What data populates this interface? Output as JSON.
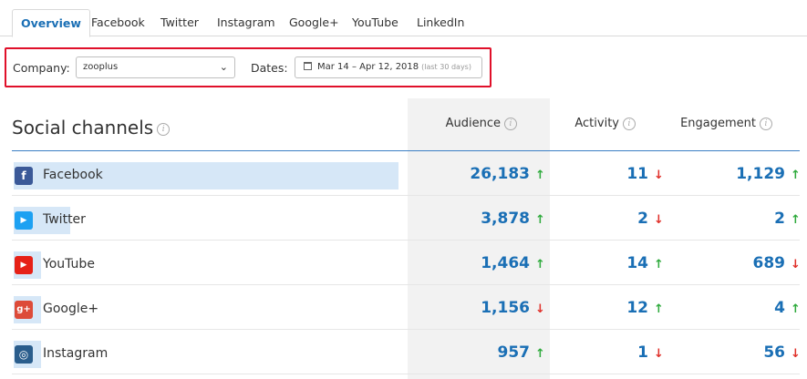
{
  "tabs": [
    {
      "label": "Overview",
      "active": true
    },
    {
      "label": "Facebook",
      "active": false
    },
    {
      "label": "Twitter",
      "active": false
    },
    {
      "label": "Instagram",
      "active": false
    },
    {
      "label": "Google+",
      "active": false
    },
    {
      "label": "YouTube",
      "active": false
    },
    {
      "label": "LinkedIn",
      "active": false
    }
  ],
  "filters": {
    "company_label": "Company:",
    "company_value": "zooplus",
    "dates_label": "Dates:",
    "dates_value": "Mar 14 – Apr 12, 2018",
    "dates_sub": "(last 30 days)"
  },
  "table": {
    "title": "Social channels",
    "columns": [
      "Audience",
      "Activity",
      "Engagement"
    ],
    "rows": [
      {
        "channel": "Facebook",
        "icon": "facebook-icon",
        "audience": "26,183",
        "audience_trend": "up",
        "activity": "11",
        "activity_trend": "down",
        "engagement": "1,129",
        "engagement_trend": "up",
        "share": 1.0
      },
      {
        "channel": "Twitter",
        "icon": "twitter-icon",
        "audience": "3,878",
        "audience_trend": "up",
        "activity": "2",
        "activity_trend": "down",
        "engagement": "2",
        "engagement_trend": "up",
        "share": 0.148
      },
      {
        "channel": "YouTube",
        "icon": "youtube-icon",
        "audience": "1,464",
        "audience_trend": "up",
        "activity": "14",
        "activity_trend": "up",
        "engagement": "689",
        "engagement_trend": "down",
        "share": 0.056
      },
      {
        "channel": "Google+",
        "icon": "google-plus-icon",
        "audience": "1,156",
        "audience_trend": "down",
        "activity": "12",
        "activity_trend": "up",
        "engagement": "4",
        "engagement_trend": "up",
        "share": 0.044
      },
      {
        "channel": "Instagram",
        "icon": "instagram-icon",
        "audience": "957",
        "audience_trend": "up",
        "activity": "1",
        "activity_trend": "down",
        "engagement": "56",
        "engagement_trend": "down",
        "share": 0.037
      }
    ]
  },
  "colors": {
    "accent": "#1a6fb5",
    "highlight_border": "#e0102a",
    "trend_up": "#2eaa3c",
    "trend_down": "#e0302a",
    "facebook": "#3b5998",
    "twitter": "#1da1f2",
    "youtube": "#e62117",
    "google_plus": "#dd4b39",
    "instagram": "#2a5d8c"
  }
}
